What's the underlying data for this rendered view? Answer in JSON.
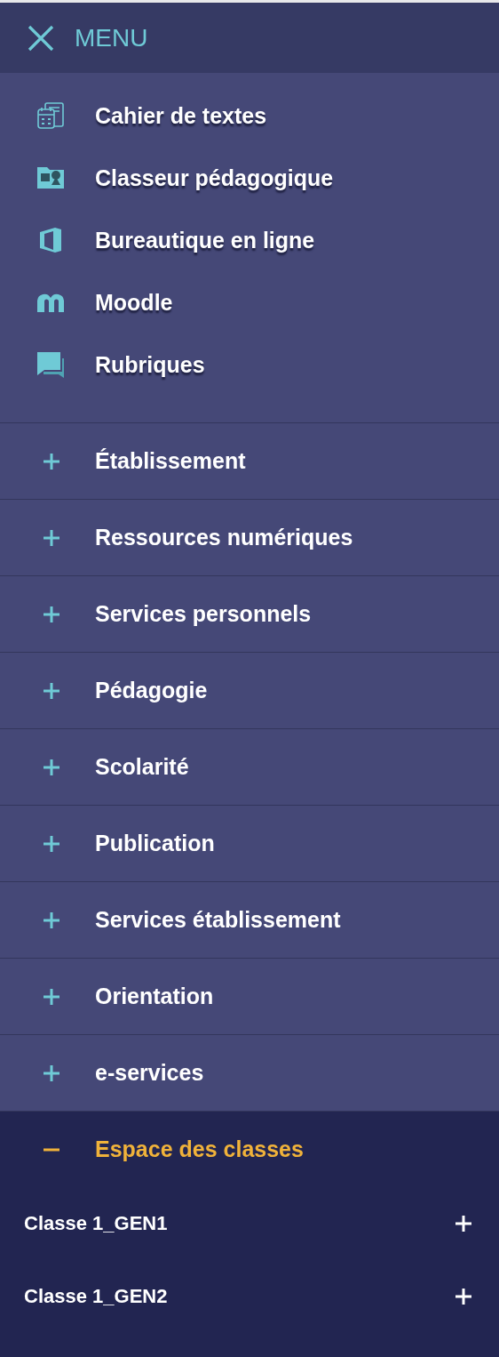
{
  "header": {
    "title": "MENU"
  },
  "apps": [
    {
      "label": "Cahier de textes",
      "kind": "calendar"
    },
    {
      "label": "Classeur pédagogique",
      "kind": "folder"
    },
    {
      "label": "Bureautique en ligne",
      "kind": "office"
    },
    {
      "label": "Moodle",
      "kind": "moodle"
    },
    {
      "label": "Rubriques",
      "kind": "chat"
    }
  ],
  "sections": [
    {
      "label": "Établissement",
      "expanded": false
    },
    {
      "label": "Ressources numériques",
      "expanded": false
    },
    {
      "label": "Services personnels",
      "expanded": false
    },
    {
      "label": "Pédagogie",
      "expanded": false
    },
    {
      "label": "Scolarité",
      "expanded": false
    },
    {
      "label": "Publication",
      "expanded": false
    },
    {
      "label": "Services établissement",
      "expanded": false
    },
    {
      "label": "Orientation",
      "expanded": false
    },
    {
      "label": "e-services",
      "expanded": false
    },
    {
      "label": "Espace des classes",
      "expanded": true,
      "children": [
        {
          "label": "Classe 1_GEN1",
          "expanded": false
        },
        {
          "label": "Classe 1_GEN2",
          "expanded": false
        }
      ]
    }
  ]
}
